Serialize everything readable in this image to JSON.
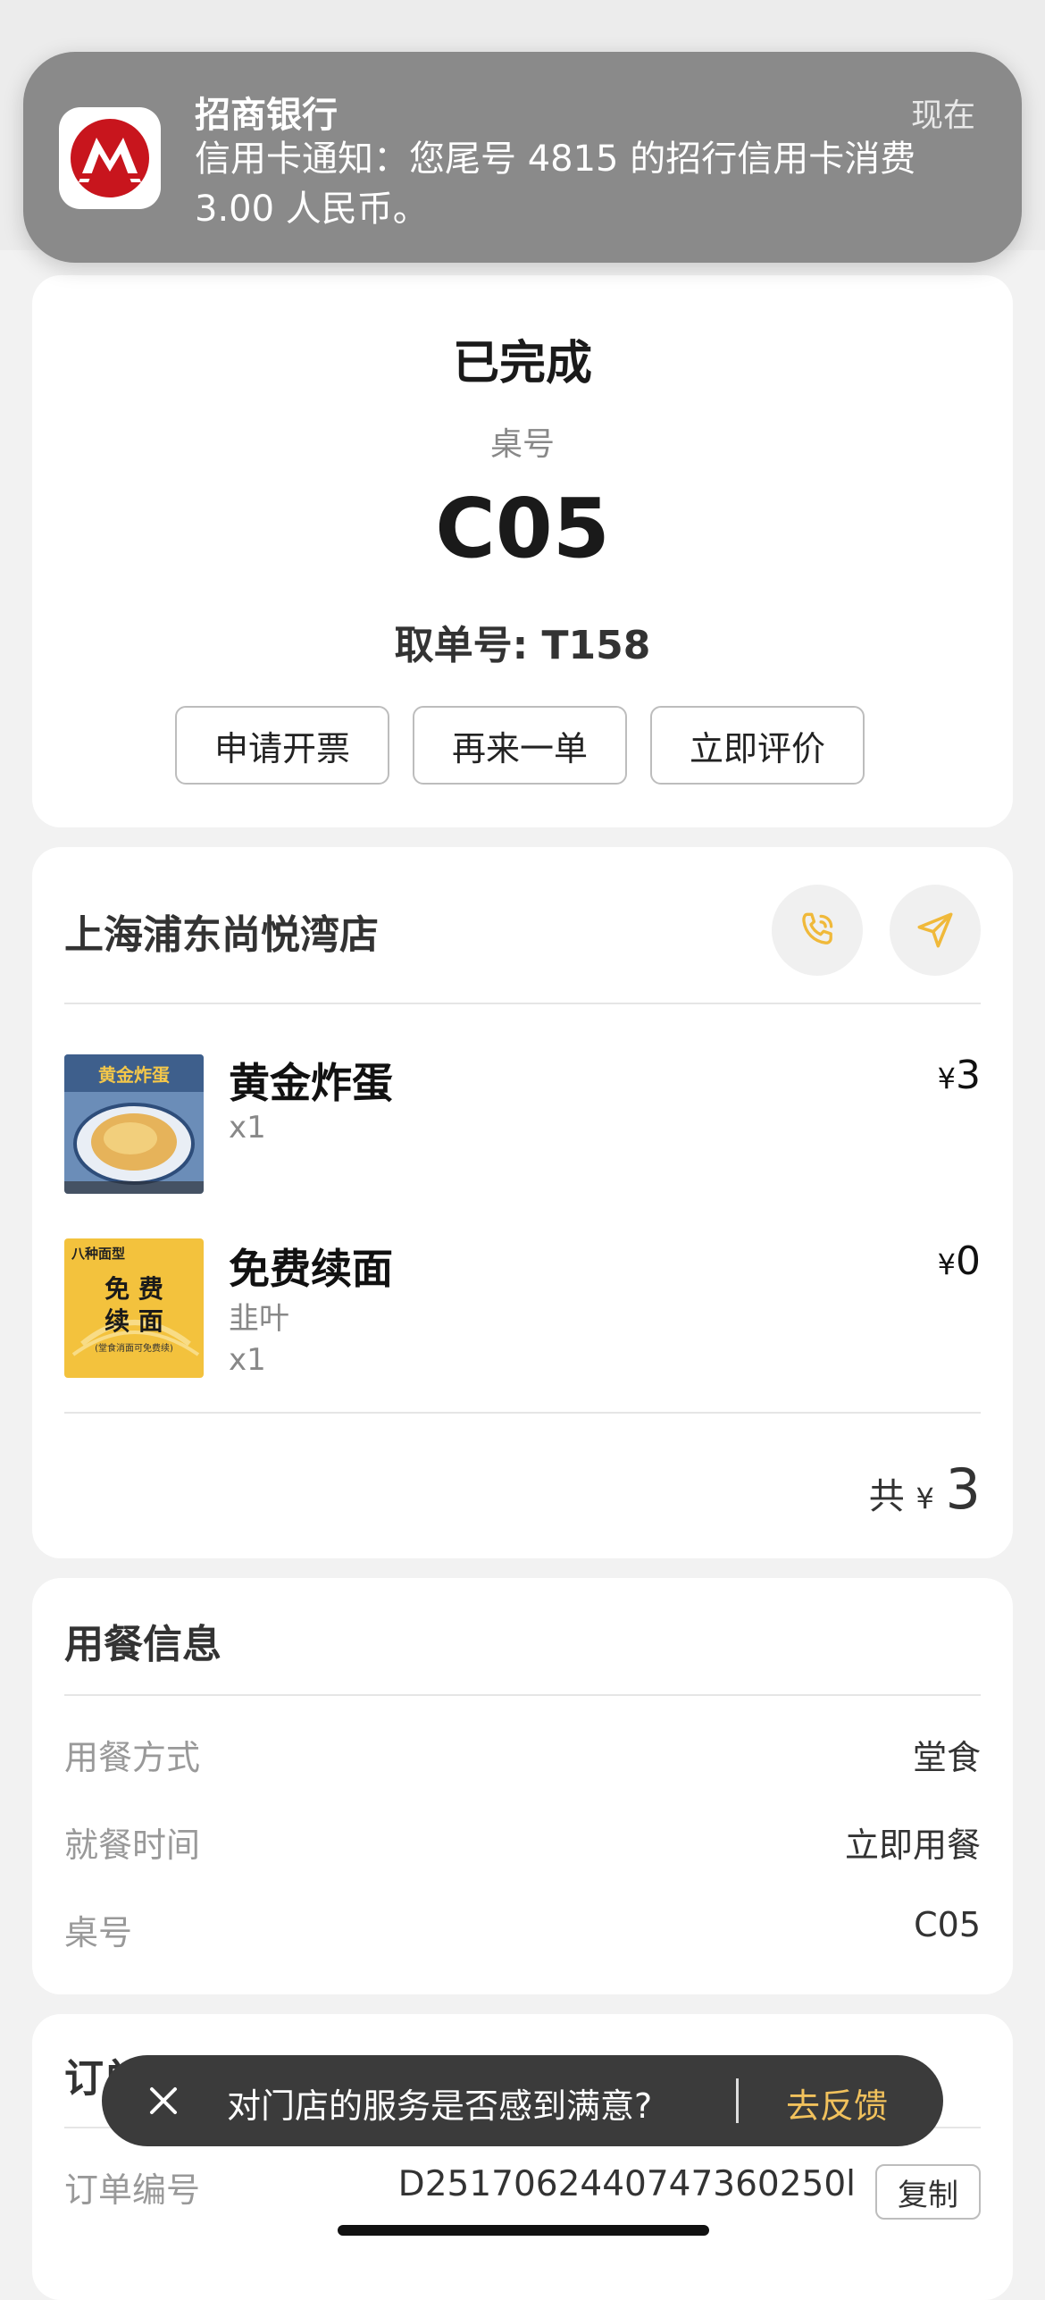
{
  "notification": {
    "app_name": "招商银行",
    "time": "现在",
    "body": "信用卡通知：您尾号 4815 的招行信用卡消费 3.00 人民币。",
    "icon": "cmb-logo-icon",
    "brand_color": "#c8151d"
  },
  "order_status": {
    "title": "已完成",
    "table_label": "桌号",
    "table_number": "C05",
    "pickup_label": "取单号: T158",
    "buttons": [
      "申请开票",
      "再来一单",
      "立即评价"
    ]
  },
  "store": {
    "name": "上海浦东尚悦湾店",
    "phone_icon": "phone-icon",
    "nav_icon": "navigation-icon",
    "accent_color": "#f0b93a",
    "items": [
      {
        "name": "黄金炸蛋",
        "options": "",
        "qty": "x1",
        "currency": "¥",
        "price": "3",
        "image": "fried-egg-image"
      },
      {
        "name": "免费续面",
        "options": "韭叶",
        "qty": "x1",
        "currency": "¥",
        "price": "0",
        "image": "free-noodle-image",
        "image_text": [
          "八种面型",
          "免 费",
          "续 面",
          "(堂食消面可免费续)"
        ]
      }
    ],
    "total_prefix": "共",
    "total_currency": "¥",
    "total_amount": "3"
  },
  "dining_info": {
    "title": "用餐信息",
    "rows": [
      {
        "label": "用餐方式",
        "value": "堂食"
      },
      {
        "label": "就餐时间",
        "value": "立即用餐"
      },
      {
        "label": "桌号",
        "value": "C05"
      }
    ]
  },
  "order_info": {
    "title": "订单信息",
    "order_no_label": "订单编号",
    "order_no": "D2517062440747360250l",
    "copy_label": "复制"
  },
  "feedback_toast": {
    "text": "对门店的服务是否感到满意?",
    "action": "去反馈",
    "close_icon": "close-icon"
  }
}
